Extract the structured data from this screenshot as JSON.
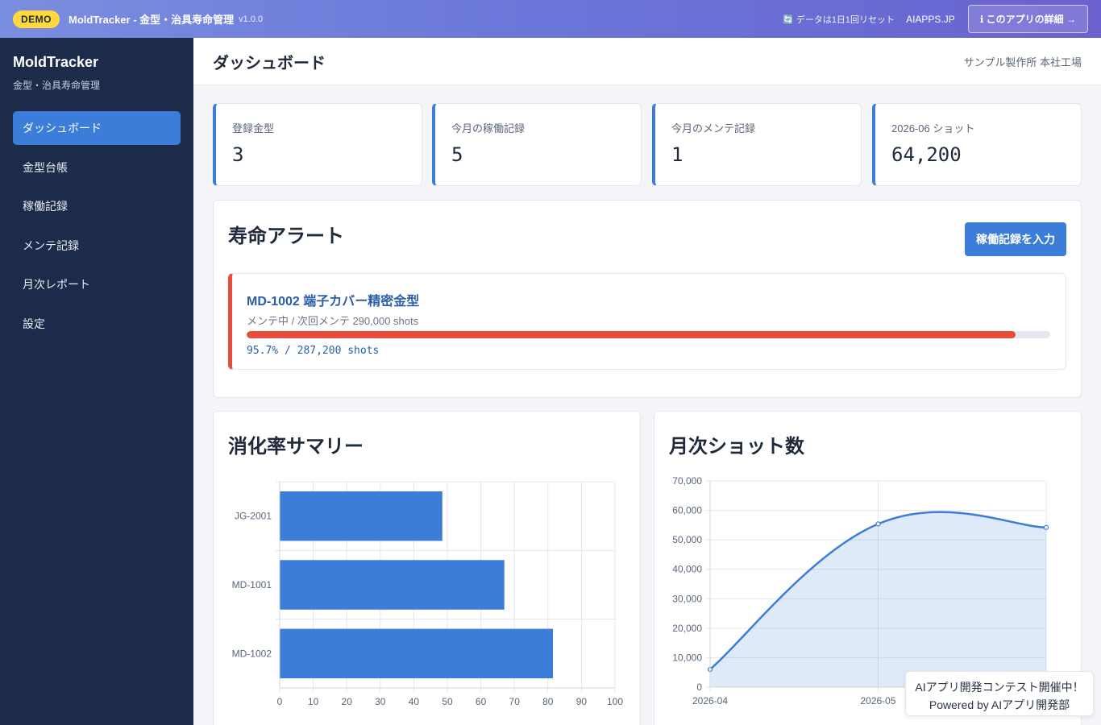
{
  "topbar": {
    "demo_badge": "DEMO",
    "app_title": "MoldTracker - 金型・治具寿命管理",
    "version": "v1.0.0",
    "reset_note": "🔄 データは1日1回リセット",
    "site_name": "AIAPPS.JP",
    "detail_button": "ℹ このアプリの詳細 →"
  },
  "sidebar": {
    "brand_name": "MoldTracker",
    "brand_sub": "金型・治具寿命管理",
    "items": [
      {
        "label": "ダッシュボード",
        "active": true
      },
      {
        "label": "金型台帳"
      },
      {
        "label": "稼働記録"
      },
      {
        "label": "メンテ記録"
      },
      {
        "label": "月次レポート"
      },
      {
        "label": "設定"
      }
    ]
  },
  "header": {
    "title": "ダッシュボード",
    "plant": "サンプル製作所 本社工場"
  },
  "stats": [
    {
      "label": "登録金型",
      "value": "3"
    },
    {
      "label": "今月の稼働記録",
      "value": "5"
    },
    {
      "label": "今月のメンテ記録",
      "value": "1"
    },
    {
      "label": "2026-06 ショット",
      "value": "64,200"
    }
  ],
  "alerts_panel": {
    "title": "寿命アラート",
    "button": "稼働記録を入力",
    "alert": {
      "title": "MD-1002 端子カバー精密金型",
      "subtitle": "メンテ中 / 次回メンテ 290,000 shots",
      "progress_percent": 95.7,
      "progress_text": "95.7% / 287,200 shots",
      "color": "#e84c3d"
    }
  },
  "summary_panel": {
    "title": "消化率サマリー"
  },
  "monthly_panel": {
    "title": "月次ショット数"
  },
  "colors": {
    "accent": "#3b7dd8",
    "sidebar_bg": "#1c2b4a",
    "alert": "#e84c3d",
    "demo_badge": "#ffd93d"
  },
  "chart_data": [
    {
      "type": "bar",
      "orientation": "horizontal",
      "categories": [
        "JG-2001",
        "MD-1001",
        "MD-1002"
      ],
      "values": [
        48.5,
        67,
        81.5
      ],
      "xlim": [
        0,
        100
      ],
      "xticks": [
        "0",
        "10",
        "20",
        "30",
        "40",
        "50",
        "60",
        "70",
        "80",
        "90",
        "100"
      ],
      "grid": true,
      "color": "#3b7dd8"
    },
    {
      "type": "area",
      "x": [
        "2026-04",
        "2026-05",
        "2026-06"
      ],
      "x_tick_labels_visible": [
        "2026-04",
        "2026-05"
      ],
      "values": [
        6000,
        55400,
        54200
      ],
      "ylim": [
        0,
        70000
      ],
      "yticks": [
        "0",
        "10,000",
        "20,000",
        "30,000",
        "40,000",
        "50,000",
        "60,000",
        "70,000"
      ],
      "grid": true,
      "color": "#3b7dd8"
    }
  ],
  "contest_badge": {
    "line1": "AIアプリ開発コンテスト開催中！",
    "line2": "Powered by AIアプリ開発部"
  }
}
